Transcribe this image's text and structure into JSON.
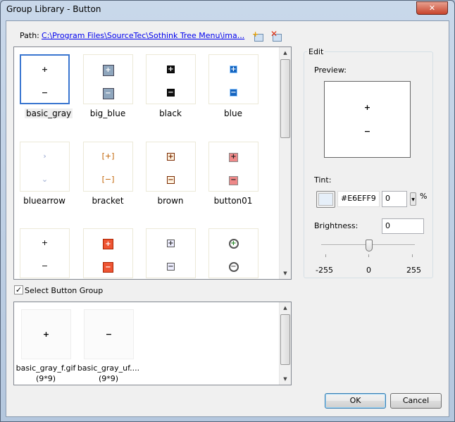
{
  "window": {
    "title": "Group Library - Button",
    "close": "✕"
  },
  "path": {
    "label": "Path:",
    "value": "C:\\Program Files\\SourceTec\\Sothink Tree Menu\\ima..."
  },
  "groups": [
    {
      "name": "basic_gray",
      "plus": "+",
      "minus": "−"
    },
    {
      "name": "big_blue",
      "plus": "+",
      "minus": "−"
    },
    {
      "name": "black",
      "plus": "+",
      "minus": "−"
    },
    {
      "name": "blue",
      "plus": "+",
      "minus": "−"
    },
    {
      "name": "bluearrow",
      "plus": "›",
      "minus": "⌄"
    },
    {
      "name": "bracket",
      "plus": "[+]",
      "minus": "[−]"
    },
    {
      "name": "brown",
      "plus": "+",
      "minus": "−"
    },
    {
      "name": "button01",
      "plus": "+",
      "minus": "−"
    },
    {
      "name": "",
      "plus": "+",
      "minus": "−"
    },
    {
      "name": "",
      "plus": "+",
      "minus": "−"
    },
    {
      "name": "",
      "plus": "+",
      "minus": "−"
    },
    {
      "name": "",
      "plus": "+",
      "minus": "−"
    }
  ],
  "select_group": {
    "label": "Select Button Group",
    "checked": true
  },
  "buttons": [
    {
      "file": "basic_gray_f.gif",
      "size": "(9*9)",
      "glyph": "+"
    },
    {
      "file": "basic_gray_uf....",
      "size": "(9*9)",
      "glyph": "−"
    }
  ],
  "edit": {
    "label": "Edit",
    "preview_label": "Preview:",
    "preview_plus": "+",
    "preview_minus": "−",
    "tint_label": "Tint:",
    "tint_color": "#E6EFF9",
    "tint_percent": "0",
    "percent_sign": "%",
    "brightness_label": "Brightness:",
    "brightness_value": "0",
    "slider": {
      "min": "-255",
      "mid": "0",
      "max": "255",
      "value": 0
    }
  },
  "ok": "OK",
  "cancel": "Cancel"
}
